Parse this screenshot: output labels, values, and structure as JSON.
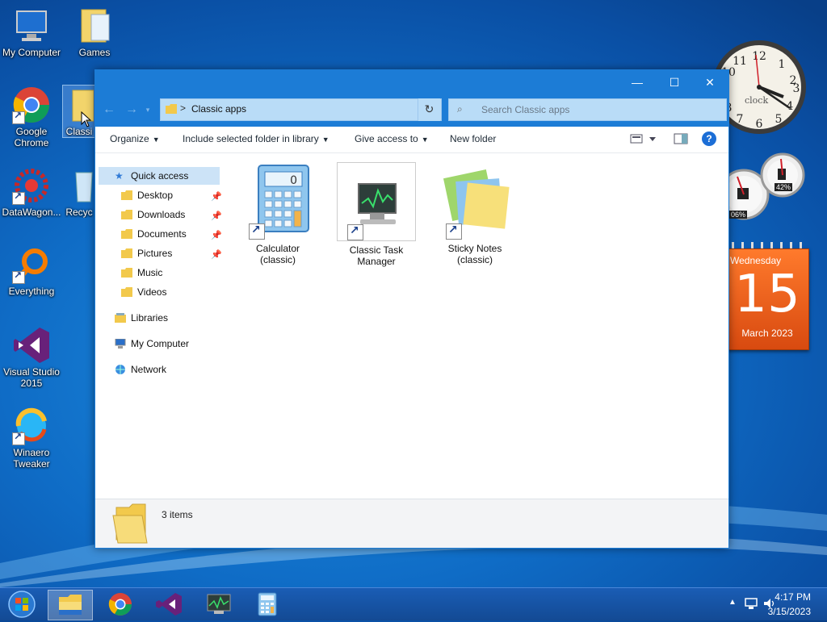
{
  "desktop": {
    "icons": [
      {
        "label": "My Computer"
      },
      {
        "label": "Games"
      },
      {
        "label": "Google Chrome"
      },
      {
        "label": "Classi"
      },
      {
        "label": "DataWagon..."
      },
      {
        "label": "Recyc"
      },
      {
        "label": "Everything"
      },
      {
        "label": "Visual Studio 2015"
      },
      {
        "label": "Winaero Tweaker"
      }
    ]
  },
  "window": {
    "title_buttons": {
      "minimize": "—",
      "maximize": "☐",
      "close": "✕"
    },
    "address": {
      "path": "Classic apps",
      "separator": ">"
    },
    "search": {
      "placeholder": "Search Classic apps"
    },
    "toolbar": {
      "organize": "Organize",
      "include_library": "Include selected folder in library",
      "give_access": "Give access to",
      "new_folder": "New folder",
      "help": "?"
    },
    "nav": {
      "quick_access": "Quick access",
      "items": [
        "Desktop",
        "Downloads",
        "Documents",
        "Pictures",
        "Music",
        "Videos"
      ],
      "libraries": "Libraries",
      "my_computer": "My Computer",
      "network": "Network"
    },
    "files": [
      {
        "label": "Calculator (classic)"
      },
      {
        "label": "Classic Task Manager"
      },
      {
        "label": "Sticky Notes (classic)"
      }
    ],
    "status": {
      "count": "3 items"
    }
  },
  "gadgets": {
    "clock_label": "clock",
    "cpu_percent": "06%",
    "mem_percent": "42%",
    "calendar": {
      "weekday": "Wednesday",
      "day": "15",
      "month_year": "March 2023"
    }
  },
  "taskbar": {
    "time": "4:17 PM",
    "date": "3/15/2023"
  },
  "colors": {
    "titlebar": "#1c7cd6",
    "calendar": "#e85a18",
    "taskbar": "#134a94"
  }
}
